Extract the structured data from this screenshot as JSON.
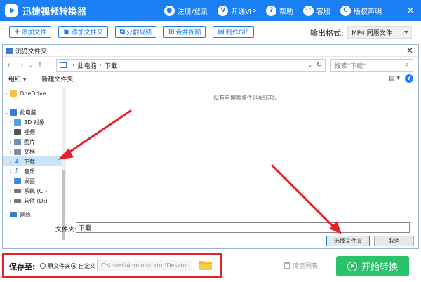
{
  "app": {
    "title": "迅捷视频转换器",
    "menu": [
      {
        "label": "注册/登录",
        "icon": "user-icon"
      },
      {
        "label": "开通VIP",
        "icon": "vip-icon"
      },
      {
        "label": "帮助",
        "icon": "help-icon"
      },
      {
        "label": "客服",
        "icon": "headset-icon"
      },
      {
        "label": "版权声明",
        "icon": "copyright-icon"
      }
    ]
  },
  "toolbar": {
    "buttons": [
      {
        "label": "添加文件",
        "icon": "plus-icon"
      },
      {
        "label": "添加文件夹",
        "icon": "folder-add-icon"
      },
      {
        "label": "分割视频",
        "icon": "split-icon"
      },
      {
        "label": "合并视频",
        "icon": "merge-icon"
      },
      {
        "label": "制作GIF",
        "icon": "gif-icon"
      }
    ],
    "output_format_label": "输出格式:",
    "output_format_value": "MP4  同原文件"
  },
  "dialog": {
    "title": "浏览文件夹",
    "address": [
      "此电脑",
      "下载"
    ],
    "search_placeholder": "搜索\"下载\"",
    "commands": [
      "组织 ▾",
      "新建文件夹"
    ],
    "tree": [
      {
        "label": "OneDrive",
        "color": "#f0c24a"
      },
      {
        "label": "此电脑",
        "color": "#3a7ad0"
      },
      {
        "label": "3D 对象",
        "color": "#49a5e0"
      },
      {
        "label": "视频",
        "color": "#555555"
      },
      {
        "label": "图片",
        "color": "#6c8fb8"
      },
      {
        "label": "文档",
        "color": "#7a8ea8"
      },
      {
        "label": "下载",
        "color": "#1a7ff2"
      },
      {
        "label": "音乐",
        "color": "#2d6fc2"
      },
      {
        "label": "桌面",
        "color": "#3d8ad6"
      },
      {
        "label": "系统 (C:)",
        "color": "#777777"
      },
      {
        "label": "软件 (D:)",
        "color": "#777777"
      },
      {
        "label": "网络",
        "color": "#3a7ad0"
      }
    ],
    "empty_message": "没有与搜索条件匹配的项。",
    "folder_label": "文件夹:",
    "folder_value": "下载",
    "select_button": "选择文件夹",
    "cancel_button": "取消"
  },
  "bottom": {
    "save_label": "保存至:",
    "option_original": "原文件夹",
    "option_custom": "自定义",
    "path": "C:\\Users\\Administrator\\Desktop",
    "clear_list": "清空列表",
    "start_button": "开始转换"
  },
  "colors": {
    "brand": "#1a7ff2",
    "start": "#29c469",
    "annotation": "#e8202b"
  }
}
